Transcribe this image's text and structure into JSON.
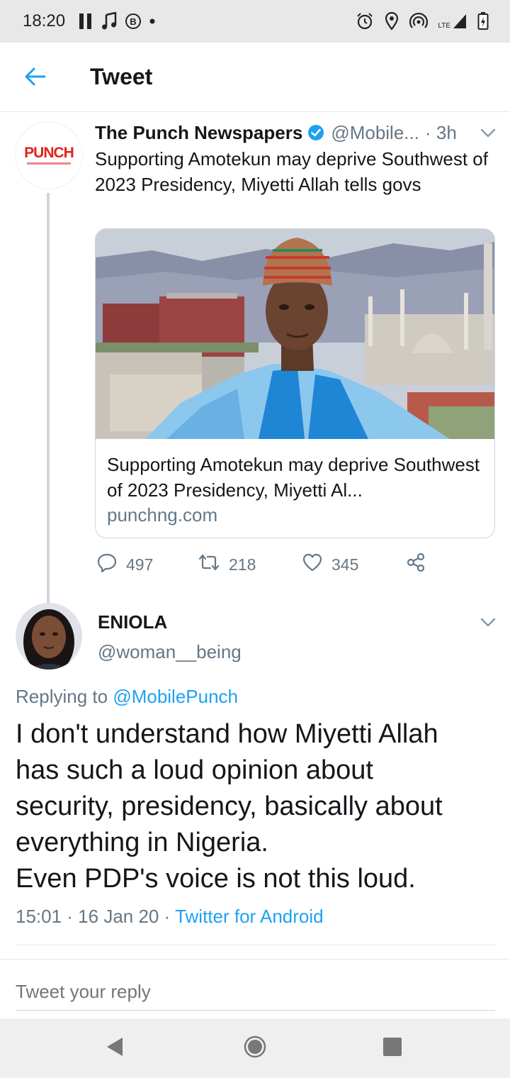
{
  "status_bar": {
    "time": "18:20",
    "left_icons": [
      "pause-icon",
      "music-note-icon",
      "b-badge-icon",
      "dot-icon"
    ],
    "right_icons": [
      "alarm-icon",
      "location-icon",
      "hotspot-icon",
      "lte-signal-icon",
      "battery-icon"
    ],
    "lte_label": "LTE"
  },
  "header": {
    "back_icon": "arrow-left-icon",
    "title": "Tweet"
  },
  "tweet": {
    "avatar_label": "PUNCH",
    "author_name": "The Punch Newspapers",
    "verified": true,
    "handle": "@Mobile...",
    "time_sep": "·",
    "time": "3h",
    "text": "Supporting Amotekun may deprive Southwest of 2023 Presidency, Miyetti Allah tells govs",
    "card": {
      "title": "Supporting Amotekun may deprive Southwest of 2023 Presidency, Miyetti Al...",
      "domain": "punchng.com"
    },
    "stats": {
      "replies": "497",
      "retweets": "218",
      "likes": "345"
    }
  },
  "reply": {
    "author_name": "ENIOLA",
    "handle": "@woman__being",
    "replying_prefix": "Replying to",
    "replying_mention": "@MobilePunch",
    "body_lines": [
      "I don't understand how Miyetti Allah",
      "has such a loud opinion about",
      "security, presidency, basically about",
      "everything in Nigeria.",
      "Even PDP's voice is not this loud."
    ],
    "timestamp": "15:01 · 16 Jan 20",
    "meta_sep": "·",
    "client": "Twitter for Android"
  },
  "compose": {
    "placeholder": "Tweet your reply"
  },
  "colors": {
    "accent": "#1da1f2",
    "secondary_text": "#657786",
    "punch_red": "#e0231b"
  }
}
